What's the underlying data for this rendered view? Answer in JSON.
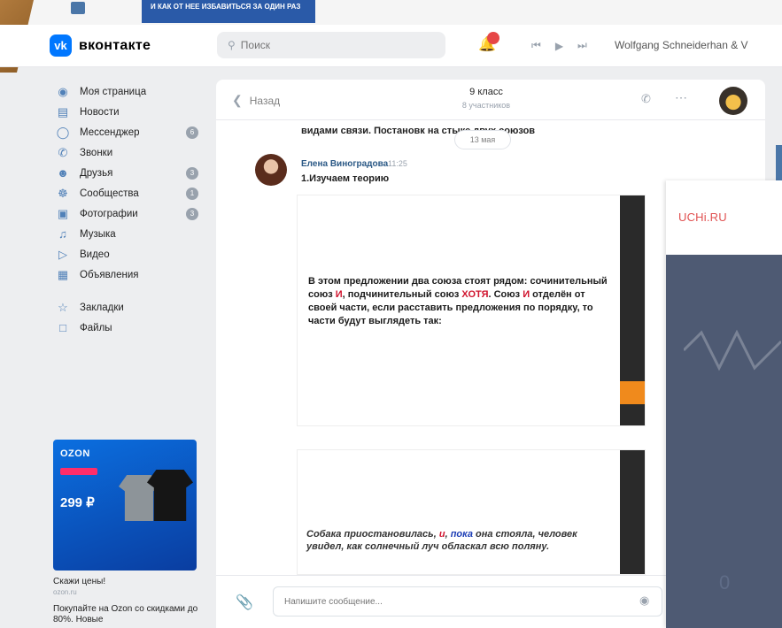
{
  "top_banner": {
    "promo_text": "И КАК ОТ НЕЕ ИЗБАВИТЬСЯ ЗА ОДИН РАЗ"
  },
  "header": {
    "logo_text": "вконтакте",
    "logo_mark": "vk",
    "search_placeholder": "Поиск",
    "now_playing": "Wolfgang Schneiderhan & V"
  },
  "nav": {
    "items": [
      {
        "label": "Моя страница",
        "icon": "user-circle-icon"
      },
      {
        "label": "Новости",
        "icon": "news-icon"
      },
      {
        "label": "Мессенджер",
        "icon": "chat-bubble-icon",
        "count": "6"
      },
      {
        "label": "Звонки",
        "icon": "phone-icon"
      },
      {
        "label": "Друзья",
        "icon": "friends-icon",
        "count": "3"
      },
      {
        "label": "Сообщества",
        "icon": "communities-icon",
        "count": "1"
      },
      {
        "label": "Фотографии",
        "icon": "photo-icon",
        "count": "3"
      },
      {
        "label": "Музыка",
        "icon": "music-icon"
      },
      {
        "label": "Видео",
        "icon": "video-icon"
      },
      {
        "label": "Объявления",
        "icon": "classifieds-icon"
      }
    ],
    "extra": [
      {
        "label": "Закладки",
        "icon": "star-icon"
      },
      {
        "label": "Файлы",
        "icon": "file-icon"
      }
    ]
  },
  "ad": {
    "brand": "OZON",
    "price": "299 ₽",
    "title": "Скажи цены!",
    "domain": "ozon.ru",
    "description": "Покупайте на Ozon со скидками до 80%. Новые"
  },
  "chat": {
    "back_label": "Назад",
    "title": "9 класс",
    "subtitle": "8 участников",
    "prev_message_tail": "видами связи. Постановк          на стыке двух союзов",
    "date_pill": "13 мая",
    "message": {
      "author": "Елена Виноградова",
      "time": "11:25",
      "text": "1.Изучаем теорию"
    },
    "image1": {
      "heading_a": "В этом предложении два союза стоят рядом: сочинительный союз ",
      "heading_i1": "И",
      "heading_b": ", подчинительный союз ",
      "heading_khotya": "ХОТЯ",
      "heading_c": ". Союз ",
      "heading_i2": "И",
      "heading_d": " отделён от своей части, если расставить предложения по порядку, то части будут выглядеть так:"
    },
    "image2": {
      "sentence_a": "Собака приостановилась, ",
      "sentence_and": "и",
      "sentence_b": ", ",
      "sentence_poka": "пока",
      "sentence_c": " она стояла, человек увидел, как солнечный луч обласкал всю поляну."
    },
    "composer_placeholder": "Напишите сообщение..."
  },
  "overlay": {
    "logo": "UCHi.RU",
    "zero": "0"
  }
}
